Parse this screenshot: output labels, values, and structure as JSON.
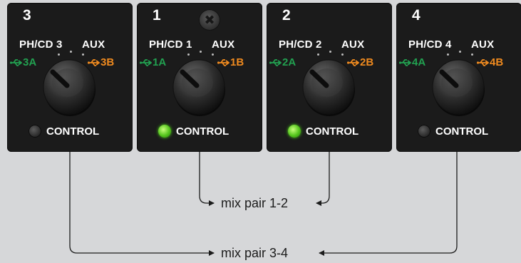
{
  "panels": [
    {
      "number": "3",
      "source_left": "PH/CD 3",
      "source_right": "AUX",
      "usb_a": "3A",
      "usb_b": "3B",
      "control_label": "CONTROL",
      "led": "off",
      "screw": false
    },
    {
      "number": "1",
      "source_left": "PH/CD 1",
      "source_right": "AUX",
      "usb_a": "1A",
      "usb_b": "1B",
      "control_label": "CONTROL",
      "led": "on",
      "screw": true
    },
    {
      "number": "2",
      "source_left": "PH/CD 2",
      "source_right": "AUX",
      "usb_a": "2A",
      "usb_b": "2B",
      "control_label": "CONTROL",
      "led": "on",
      "screw": false
    },
    {
      "number": "4",
      "source_left": "PH/CD 4",
      "source_right": "AUX",
      "usb_a": "4A",
      "usb_b": "4B",
      "control_label": "CONTROL",
      "led": "off",
      "screw": false
    }
  ],
  "mix_pairs": [
    {
      "label": "mix pair 1-2",
      "connects": [
        "1",
        "2"
      ]
    },
    {
      "label": "mix pair 3-4",
      "connects": [
        "3",
        "4"
      ]
    }
  ],
  "colors": {
    "panel": "#1b1b1b",
    "usb_a": "#22a050",
    "usb_b": "#ef8a1f",
    "led_on": "#53c41c",
    "background": "#d6d7d9"
  },
  "icons": {
    "screw": "screw-icon",
    "usb": "usb-icon",
    "knob": "knob-icon",
    "led": "led-indicator"
  }
}
